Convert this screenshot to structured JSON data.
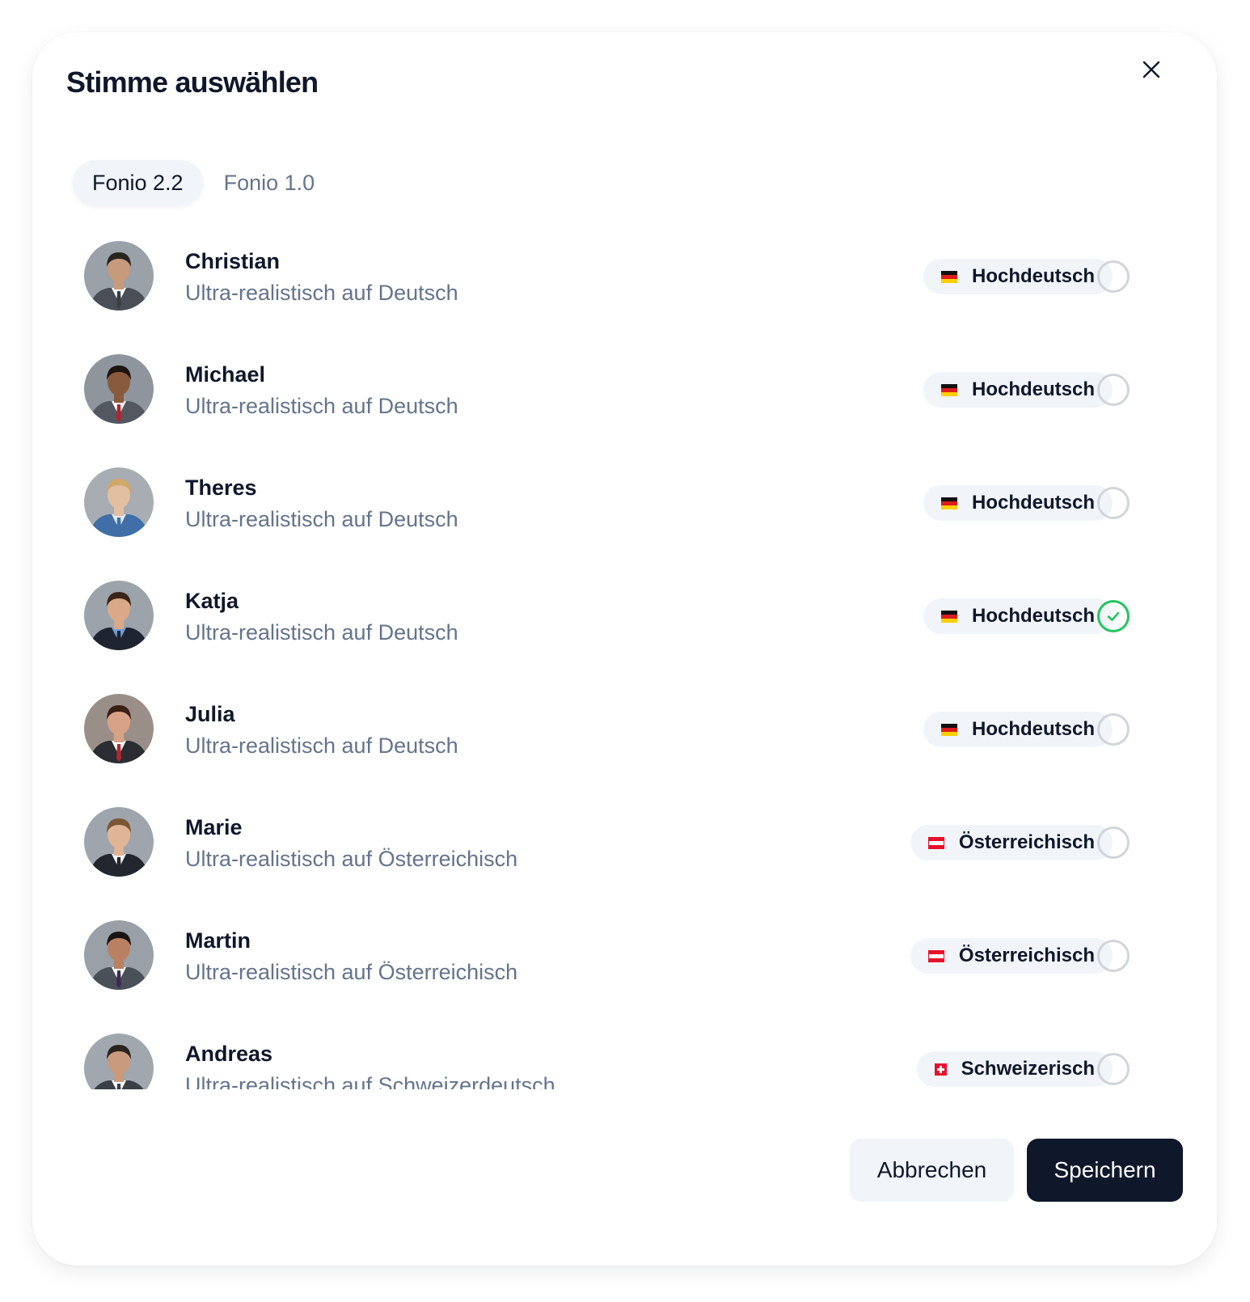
{
  "dialog": {
    "title": "Stimme auswählen",
    "close_icon": "close-icon"
  },
  "tabs": [
    {
      "label": "Fonio 2.2",
      "active": true
    },
    {
      "label": "Fonio 1.0",
      "active": false
    }
  ],
  "voices": [
    {
      "name": "Christian",
      "description": "Ultra-realistisch auf Deutsch",
      "language": "Hochdeutsch",
      "flag": "flag-de-icon",
      "selected": false,
      "avatar_colors": {
        "bg": "#9aa1a8",
        "skin": "#c89a7c",
        "hair": "#2a2420",
        "suit": "#4a4f57",
        "shirt": "#ffffff",
        "tie": "#3a3f46"
      }
    },
    {
      "name": "Michael",
      "description": "Ultra-realistisch auf Deutsch",
      "language": "Hochdeutsch",
      "flag": "flag-de-icon",
      "selected": false,
      "avatar_colors": {
        "bg": "#8e959c",
        "skin": "#8a5a3c",
        "hair": "#1c1410",
        "suit": "#535860",
        "shirt": "#ffffff",
        "tie": "#b3242e"
      }
    },
    {
      "name": "Theres",
      "description": "Ultra-realistisch auf Deutsch",
      "language": "Hochdeutsch",
      "flag": "flag-de-icon",
      "selected": false,
      "avatar_colors": {
        "bg": "#a7adb3",
        "skin": "#e3bfa2",
        "hair": "#cfa86a",
        "suit": "#3f6fa6",
        "shirt": "#dfe7f0",
        "tie": "#3f6fa6"
      }
    },
    {
      "name": "Katja",
      "description": "Ultra-realistisch auf Deutsch",
      "language": "Hochdeutsch",
      "flag": "flag-de-icon",
      "selected": true,
      "avatar_colors": {
        "bg": "#9ca3aa",
        "skin": "#d9a98a",
        "hair": "#3a2418",
        "suit": "#1f2530",
        "shirt": "#6fa0d8",
        "tie": "#1f2530"
      }
    },
    {
      "name": "Julia",
      "description": "Ultra-realistisch auf Deutsch",
      "language": "Hochdeutsch",
      "flag": "flag-de-icon",
      "selected": false,
      "avatar_colors": {
        "bg": "#9a8f88",
        "skin": "#d8a286",
        "hair": "#3b2016",
        "suit": "#2b2d33",
        "shirt": "#ffffff",
        "tie": "#b0282f"
      }
    },
    {
      "name": "Marie",
      "description": "Ultra-realistisch auf Österreichisch",
      "language": "Österreichisch",
      "flag": "flag-at-icon",
      "selected": false,
      "avatar_colors": {
        "bg": "#9ea5ac",
        "skin": "#e0b596",
        "hair": "#7a5634",
        "suit": "#22262e",
        "shirt": "#f4f4f4",
        "tie": "#22262e"
      }
    },
    {
      "name": "Martin",
      "description": "Ultra-realistisch auf Österreichisch",
      "language": "Österreichisch",
      "flag": "flag-at-icon",
      "selected": false,
      "avatar_colors": {
        "bg": "#99a0a7",
        "skin": "#b98063",
        "hair": "#1a1412",
        "suit": "#4a5058",
        "shirt": "#ffffff",
        "tie": "#3c2a55"
      }
    },
    {
      "name": "Andreas",
      "description": "Ultra-realistisch auf Schweizerdeutsch",
      "language": "Schweizerisch",
      "flag": "flag-ch-icon",
      "selected": false,
      "avatar_colors": {
        "bg": "#a0a7ae",
        "skin": "#c99a7e",
        "hair": "#2a2420",
        "suit": "#3a3f46",
        "shirt": "#ffffff",
        "tie": "#3a3f46"
      }
    }
  ],
  "footer": {
    "cancel_label": "Abbrechen",
    "save_label": "Speichern"
  },
  "colors": {
    "primary": "#0f172a",
    "muted": "#64748b",
    "chip_bg": "#f1f5f9",
    "success": "#22c55e",
    "radio_border": "#d1d5db"
  }
}
